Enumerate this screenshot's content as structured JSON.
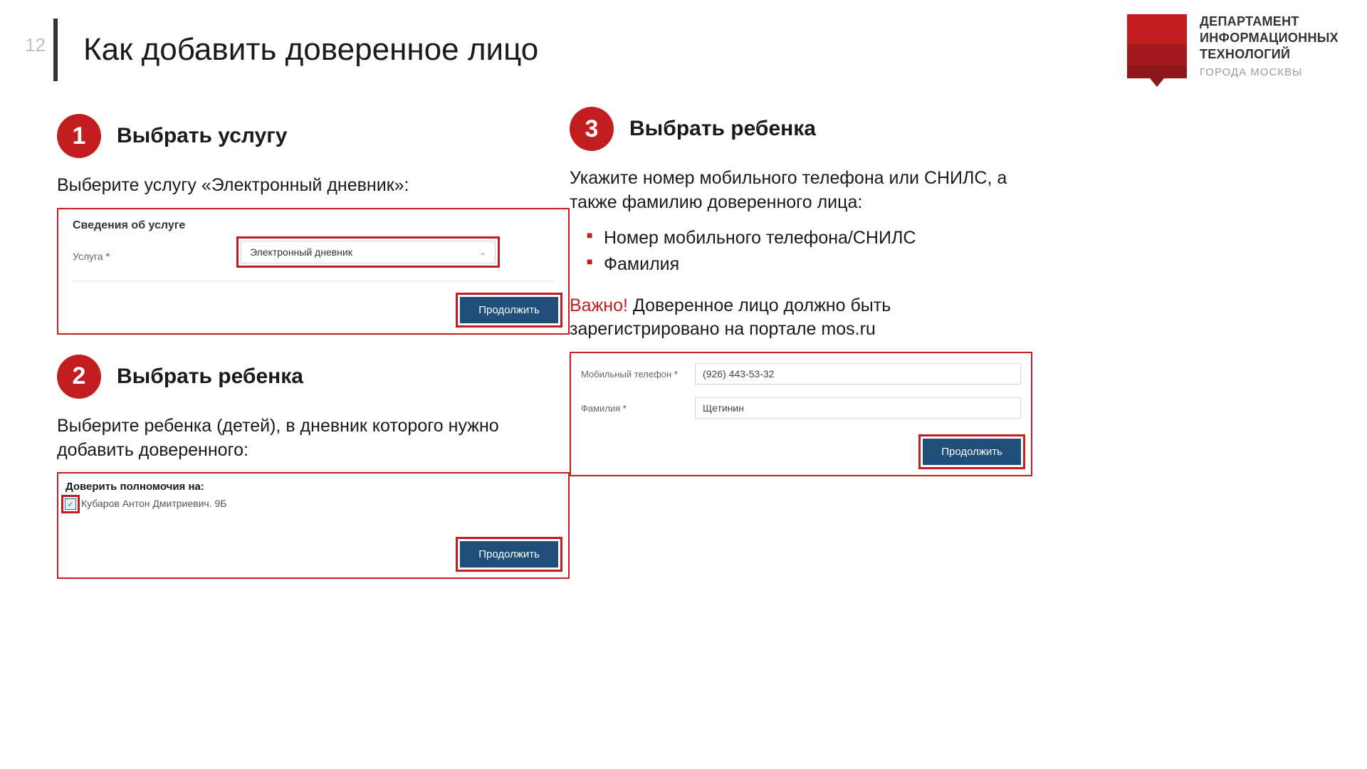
{
  "page_number": "12",
  "page_title": "Как добавить доверенное лицо",
  "logo": {
    "line1": "ДЕПАРТАМЕНТ",
    "line2": "ИНФОРМАЦИОННЫХ",
    "line3": "ТЕХНОЛОГИЙ",
    "city": "ГОРОДА МОСКВЫ"
  },
  "step1": {
    "num": "1",
    "title": "Выбрать услугу",
    "desc": "Выберите услугу «Электронный дневник»:",
    "panel_heading": "Сведения об услуге",
    "field_label": "Услуга",
    "select_value": "Электронный дневник",
    "button": "Продолжить"
  },
  "step2": {
    "num": "2",
    "title": "Выбрать ребенка",
    "desc": "Выберите ребенка (детей), в дневник которого нужно добавить доверенного:",
    "panel_heading": "Доверить полномочия на:",
    "child_row": "Кубаров Антон Дмитриевич. 9Б",
    "button": "Продолжить"
  },
  "step3": {
    "num": "3",
    "title": "Выбрать ребенка",
    "desc_lead": "Укажите номер мобильного телефона или СНИЛС, а также фамилию доверенного лица:",
    "bullets": [
      "Номер мобильного телефона/СНИЛС",
      "Фамилия"
    ],
    "important_label": "Важно!",
    "important_text": " Доверенное лицо должно быть зарегистрировано на портале mos.ru",
    "phone_label": "Мобильный телефон",
    "phone_value": "(926) 443-53-32",
    "surname_label": "Фамилия",
    "surname_value": "Щетинин",
    "button": "Продолжить"
  }
}
